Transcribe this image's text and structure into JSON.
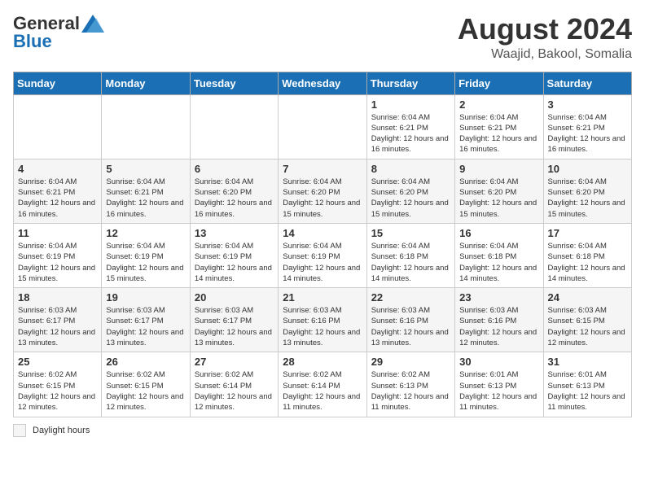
{
  "header": {
    "logo_general": "General",
    "logo_blue": "Blue",
    "month_year": "August 2024",
    "location": "Waajid, Bakool, Somalia"
  },
  "weekdays": [
    "Sunday",
    "Monday",
    "Tuesday",
    "Wednesday",
    "Thursday",
    "Friday",
    "Saturday"
  ],
  "footer": {
    "daylight_label": "Daylight hours"
  },
  "weeks": [
    [
      {
        "day": "",
        "info": ""
      },
      {
        "day": "",
        "info": ""
      },
      {
        "day": "",
        "info": ""
      },
      {
        "day": "",
        "info": ""
      },
      {
        "day": "1",
        "info": "Sunrise: 6:04 AM\nSunset: 6:21 PM\nDaylight: 12 hours\nand 16 minutes."
      },
      {
        "day": "2",
        "info": "Sunrise: 6:04 AM\nSunset: 6:21 PM\nDaylight: 12 hours\nand 16 minutes."
      },
      {
        "day": "3",
        "info": "Sunrise: 6:04 AM\nSunset: 6:21 PM\nDaylight: 12 hours\nand 16 minutes."
      }
    ],
    [
      {
        "day": "4",
        "info": "Sunrise: 6:04 AM\nSunset: 6:21 PM\nDaylight: 12 hours\nand 16 minutes."
      },
      {
        "day": "5",
        "info": "Sunrise: 6:04 AM\nSunset: 6:21 PM\nDaylight: 12 hours\nand 16 minutes."
      },
      {
        "day": "6",
        "info": "Sunrise: 6:04 AM\nSunset: 6:20 PM\nDaylight: 12 hours\nand 16 minutes."
      },
      {
        "day": "7",
        "info": "Sunrise: 6:04 AM\nSunset: 6:20 PM\nDaylight: 12 hours\nand 15 minutes."
      },
      {
        "day": "8",
        "info": "Sunrise: 6:04 AM\nSunset: 6:20 PM\nDaylight: 12 hours\nand 15 minutes."
      },
      {
        "day": "9",
        "info": "Sunrise: 6:04 AM\nSunset: 6:20 PM\nDaylight: 12 hours\nand 15 minutes."
      },
      {
        "day": "10",
        "info": "Sunrise: 6:04 AM\nSunset: 6:20 PM\nDaylight: 12 hours\nand 15 minutes."
      }
    ],
    [
      {
        "day": "11",
        "info": "Sunrise: 6:04 AM\nSunset: 6:19 PM\nDaylight: 12 hours\nand 15 minutes."
      },
      {
        "day": "12",
        "info": "Sunrise: 6:04 AM\nSunset: 6:19 PM\nDaylight: 12 hours\nand 15 minutes."
      },
      {
        "day": "13",
        "info": "Sunrise: 6:04 AM\nSunset: 6:19 PM\nDaylight: 12 hours\nand 14 minutes."
      },
      {
        "day": "14",
        "info": "Sunrise: 6:04 AM\nSunset: 6:19 PM\nDaylight: 12 hours\nand 14 minutes."
      },
      {
        "day": "15",
        "info": "Sunrise: 6:04 AM\nSunset: 6:18 PM\nDaylight: 12 hours\nand 14 minutes."
      },
      {
        "day": "16",
        "info": "Sunrise: 6:04 AM\nSunset: 6:18 PM\nDaylight: 12 hours\nand 14 minutes."
      },
      {
        "day": "17",
        "info": "Sunrise: 6:04 AM\nSunset: 6:18 PM\nDaylight: 12 hours\nand 14 minutes."
      }
    ],
    [
      {
        "day": "18",
        "info": "Sunrise: 6:03 AM\nSunset: 6:17 PM\nDaylight: 12 hours\nand 13 minutes."
      },
      {
        "day": "19",
        "info": "Sunrise: 6:03 AM\nSunset: 6:17 PM\nDaylight: 12 hours\nand 13 minutes."
      },
      {
        "day": "20",
        "info": "Sunrise: 6:03 AM\nSunset: 6:17 PM\nDaylight: 12 hours\nand 13 minutes."
      },
      {
        "day": "21",
        "info": "Sunrise: 6:03 AM\nSunset: 6:16 PM\nDaylight: 12 hours\nand 13 minutes."
      },
      {
        "day": "22",
        "info": "Sunrise: 6:03 AM\nSunset: 6:16 PM\nDaylight: 12 hours\nand 13 minutes."
      },
      {
        "day": "23",
        "info": "Sunrise: 6:03 AM\nSunset: 6:16 PM\nDaylight: 12 hours\nand 12 minutes."
      },
      {
        "day": "24",
        "info": "Sunrise: 6:03 AM\nSunset: 6:15 PM\nDaylight: 12 hours\nand 12 minutes."
      }
    ],
    [
      {
        "day": "25",
        "info": "Sunrise: 6:02 AM\nSunset: 6:15 PM\nDaylight: 12 hours\nand 12 minutes."
      },
      {
        "day": "26",
        "info": "Sunrise: 6:02 AM\nSunset: 6:15 PM\nDaylight: 12 hours\nand 12 minutes."
      },
      {
        "day": "27",
        "info": "Sunrise: 6:02 AM\nSunset: 6:14 PM\nDaylight: 12 hours\nand 12 minutes."
      },
      {
        "day": "28",
        "info": "Sunrise: 6:02 AM\nSunset: 6:14 PM\nDaylight: 12 hours\nand 11 minutes."
      },
      {
        "day": "29",
        "info": "Sunrise: 6:02 AM\nSunset: 6:13 PM\nDaylight: 12 hours\nand 11 minutes."
      },
      {
        "day": "30",
        "info": "Sunrise: 6:01 AM\nSunset: 6:13 PM\nDaylight: 12 hours\nand 11 minutes."
      },
      {
        "day": "31",
        "info": "Sunrise: 6:01 AM\nSunset: 6:13 PM\nDaylight: 12 hours\nand 11 minutes."
      }
    ]
  ]
}
